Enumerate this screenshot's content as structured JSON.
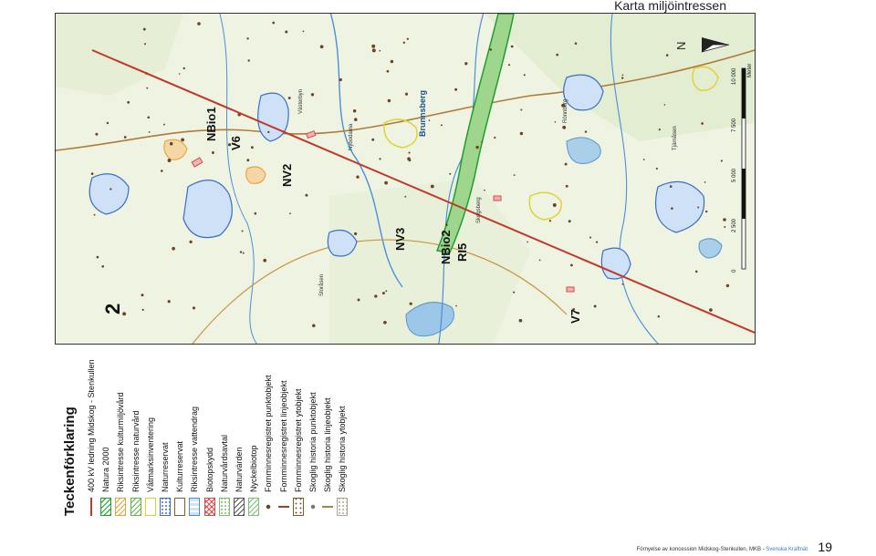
{
  "header": {
    "title": "Karta miljöintressen"
  },
  "map": {
    "corridor_label": "2",
    "labels": [
      "NBio1",
      "V6",
      "NV2",
      "NV3",
      "NBio2",
      "RI5",
      "V7"
    ],
    "places": [
      "Brunnsberg",
      "Storåsen",
      "Nybodarna",
      "Västerbyn",
      "Rönnberg",
      "Tjärnåsen",
      "Skogsberg"
    ],
    "north": "N",
    "scale": {
      "ticks": [
        "0",
        "2 500",
        "5 000",
        "7 500",
        "10 000"
      ],
      "unit": "Meter"
    }
  },
  "legend": {
    "title": "Teckenförklaring",
    "items": [
      {
        "label": "400 kV ledning Midskog - Stenkullen",
        "type": "line",
        "color": "#c0392b"
      },
      {
        "label": "Natura 2000",
        "type": "hatch",
        "color": "#1f9e2e"
      },
      {
        "label": "Riksintresse kulturmiljövård",
        "type": "hatch",
        "color": "#e8a33a"
      },
      {
        "label": "Riksintresse naturvård",
        "type": "hatch",
        "color": "#62b843"
      },
      {
        "label": "Våtmarksinventering",
        "type": "box",
        "color": "#e0d22c"
      },
      {
        "label": "Naturreservat",
        "type": "dots",
        "color": "#3a6fc4"
      },
      {
        "label": "Kulturreservat",
        "type": "box",
        "color": "#8a5a2b"
      },
      {
        "label": "Riksintresse vattendrag",
        "type": "wave",
        "color": "#4a90d9"
      },
      {
        "label": "Biotopskydd",
        "type": "cross",
        "color": "#d94a4a"
      },
      {
        "label": "Naturvårdsavtal",
        "type": "dots",
        "color": "#7fbf6a"
      },
      {
        "label": "Naturvärden",
        "type": "hatch",
        "color": "#555555"
      },
      {
        "label": "Nyckelbiotop",
        "type": "hatch",
        "color": "#7cc07a"
      },
      {
        "label": "Fornminnesregistret punktobjekt",
        "type": "point",
        "color": "#6b4423"
      },
      {
        "label": "Fornminnesregistret linjeobjekt",
        "type": "linev",
        "color": "#8a4a2a"
      },
      {
        "label": "Fornminnesregistret ytobjekt",
        "type": "dotbox",
        "color": "#8a5a2b"
      },
      {
        "label": "Skoglig historia punktobjekt",
        "type": "point",
        "color": "#777777"
      },
      {
        "label": "Skoglig historia linjeobjekt",
        "type": "linev",
        "color": "#a08a40"
      },
      {
        "label": "Skoglig historia ytobjekt",
        "type": "dots",
        "color": "#b0a890"
      }
    ]
  },
  "footer": {
    "caption": "Förnyelse av koncession Midskog-Stenkullen, MKB -",
    "brand": "Svenska Kraftnät",
    "page": "19"
  }
}
